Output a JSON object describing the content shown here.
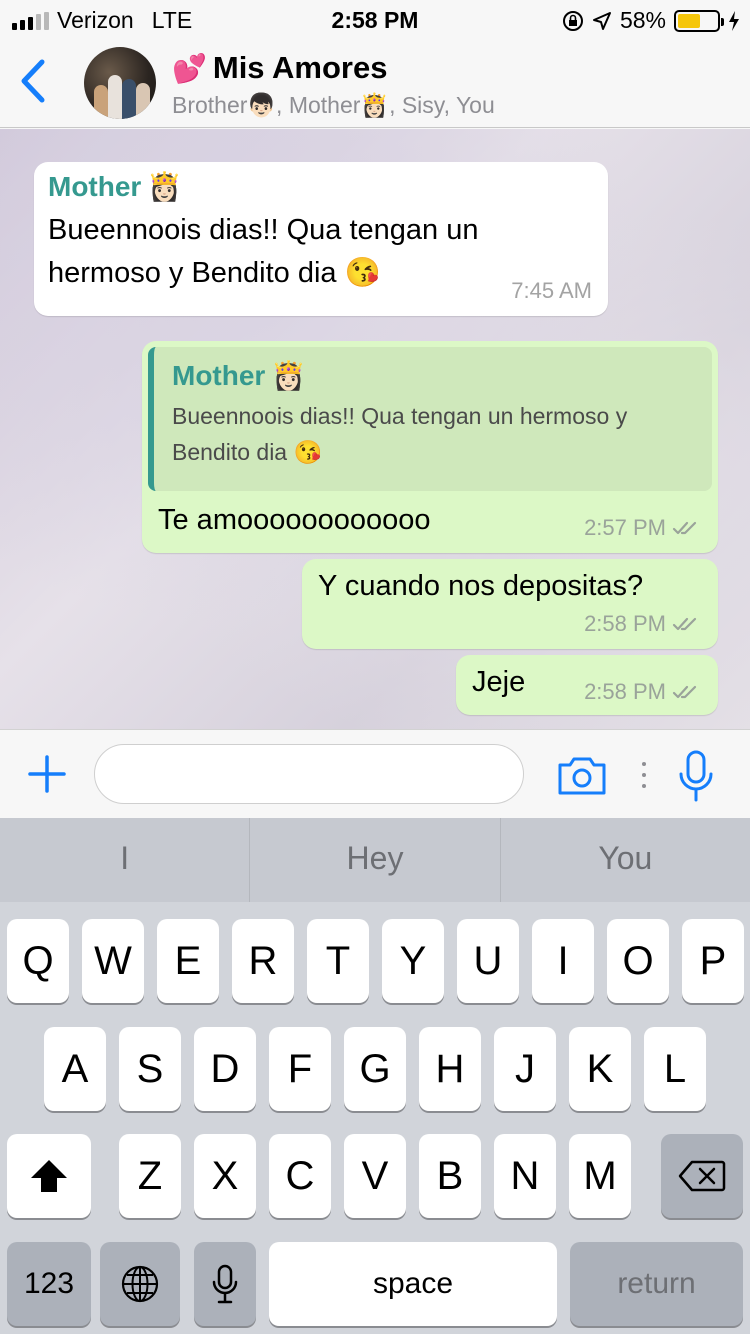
{
  "status_bar": {
    "carrier": "Verizon",
    "network": "LTE",
    "time": "2:58 PM",
    "battery_percent": "58%",
    "battery_level": 0.58
  },
  "header": {
    "title": "Mis Amores",
    "title_emoji": "💕",
    "subtitle": "Brother👦🏻, Mother👸🏻, Sisy, You"
  },
  "messages": [
    {
      "direction": "in",
      "sender": "Mother",
      "sender_emoji": "👸🏻",
      "text": "Bueennoois dias!! Qua tengan un hermoso y Bendito dia 😘",
      "time": "7:45 AM"
    },
    {
      "direction": "out",
      "quote_sender": "Mother",
      "quote_sender_emoji": "👸🏻",
      "quote_text": "Bueennoois dias!! Qua tengan un hermoso y Bendito dia 😘",
      "text": "Te amoooooooooooo",
      "time": "2:57 PM"
    },
    {
      "direction": "out",
      "text": "Y cuando nos depositas?",
      "time": "2:58 PM"
    },
    {
      "direction": "out",
      "text": "Jeje",
      "time": "2:58 PM"
    }
  ],
  "composer": {
    "placeholder": "",
    "icons": [
      "plus-icon",
      "camera-icon",
      "more-icon",
      "mic-icon"
    ]
  },
  "keyboard": {
    "suggestions": [
      "I",
      "Hey",
      "You"
    ],
    "row1": [
      "Q",
      "W",
      "E",
      "R",
      "T",
      "Y",
      "U",
      "I",
      "O",
      "P"
    ],
    "row2": [
      "A",
      "S",
      "D",
      "F",
      "G",
      "H",
      "J",
      "K",
      "L"
    ],
    "row3": [
      "Z",
      "X",
      "C",
      "V",
      "B",
      "N",
      "M"
    ],
    "numbers_key": "123",
    "space_key": "space",
    "return_key": "return"
  },
  "colors": {
    "accent_blue": "#157efb",
    "sender_green": "#35998f",
    "outgoing_bubble": "#dcf8c6",
    "incoming_bubble": "#ffffff"
  }
}
